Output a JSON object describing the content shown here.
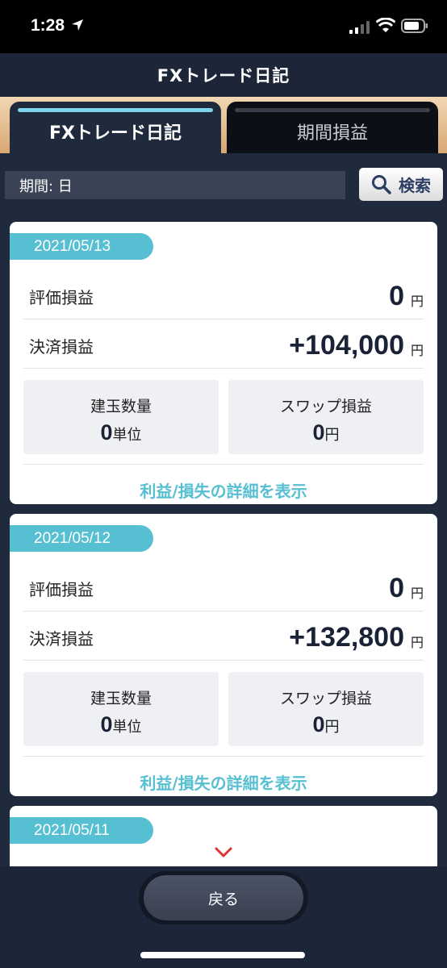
{
  "status_bar": {
    "time": "1:28"
  },
  "nav": {
    "title": "FXトレード日記"
  },
  "tabs": [
    {
      "label": "FXトレード日記",
      "active": true
    },
    {
      "label": "期間損益",
      "active": false
    }
  ],
  "filter": {
    "period": "期間: 日",
    "search_label": "検索"
  },
  "entries": [
    {
      "date": "2021/05/13",
      "unrealized_label": "評価損益",
      "unrealized_value": "0",
      "unrealized_unit": "円",
      "realized_label": "決済損益",
      "realized_value": "+104,000",
      "realized_unit": "円",
      "position_label": "建玉数量",
      "position_value": "0",
      "position_unit": "単位",
      "swap_label": "スワップ損益",
      "swap_value": "0",
      "swap_unit": "円",
      "detail_link": "利益/損失の詳細を表示"
    },
    {
      "date": "2021/05/12",
      "unrealized_label": "評価損益",
      "unrealized_value": "0",
      "unrealized_unit": "円",
      "realized_label": "決済損益",
      "realized_value": "+132,800",
      "realized_unit": "円",
      "position_label": "建玉数量",
      "position_value": "0",
      "position_unit": "単位",
      "swap_label": "スワップ損益",
      "swap_value": "0",
      "swap_unit": "円",
      "detail_link": "利益/損失の詳細を表示"
    },
    {
      "date": "2021/05/11"
    }
  ],
  "bottom": {
    "back_label": "戻る"
  },
  "colors": {
    "accent": "#57bfd2",
    "background": "#1f2a3d",
    "chevron": "#e0322e"
  }
}
